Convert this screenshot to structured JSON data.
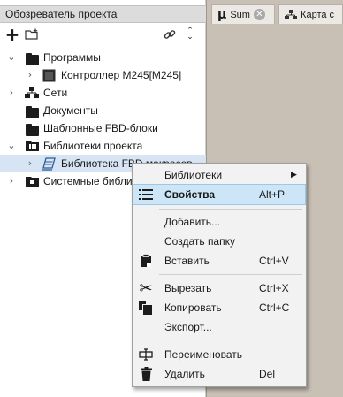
{
  "panel": {
    "title": "Обозреватель проекта"
  },
  "tabs": [
    {
      "label": "Sum",
      "icon": "mu-icon"
    },
    {
      "label": "Карта с",
      "icon": "network-icon"
    }
  ],
  "tree": [
    {
      "label": "Программы",
      "expanded": true,
      "icon": "folder-icon"
    },
    {
      "label": "Контроллер M245[M245]",
      "expanded": false,
      "icon": "controller-icon"
    },
    {
      "label": "Сети",
      "expanded": false,
      "icon": "network-icon"
    },
    {
      "label": "Документы",
      "icon": "folder-icon"
    },
    {
      "label": "Шаблонные FBD-блоки",
      "icon": "folder-icon"
    },
    {
      "label": "Библиотеки проекта",
      "expanded": true,
      "icon": "library-folder-icon"
    },
    {
      "label": "Библиотека FBD макросов",
      "expanded": false,
      "icon": "library-icon"
    },
    {
      "label": "Системные библи",
      "expanded": false,
      "icon": "system-folder-icon"
    }
  ],
  "context_menu": {
    "items": [
      {
        "label": "Библиотеки",
        "shortcut": "",
        "submenu": true
      },
      {
        "label": "Свойства",
        "shortcut": "Alt+P",
        "highlighted": true,
        "icon": "properties-icon"
      },
      {
        "label": "Добавить...",
        "shortcut": ""
      },
      {
        "label": "Создать папку",
        "shortcut": ""
      },
      {
        "label": "Вставить",
        "shortcut": "Ctrl+V",
        "icon": "paste-icon"
      },
      {
        "label": "Вырезать",
        "shortcut": "Ctrl+X",
        "icon": "cut-icon"
      },
      {
        "label": "Копировать",
        "shortcut": "Ctrl+C",
        "icon": "copy-icon"
      },
      {
        "label": "Экспорт...",
        "shortcut": ""
      },
      {
        "label": "Переименовать",
        "shortcut": "",
        "icon": "rename-icon"
      },
      {
        "label": "Удалить",
        "shortcut": "Del",
        "icon": "delete-icon"
      }
    ]
  },
  "colors": {
    "selection": "#d7e4f4",
    "menu_highlight": "#cde6f7",
    "editor_background": "#c8c0b5"
  }
}
